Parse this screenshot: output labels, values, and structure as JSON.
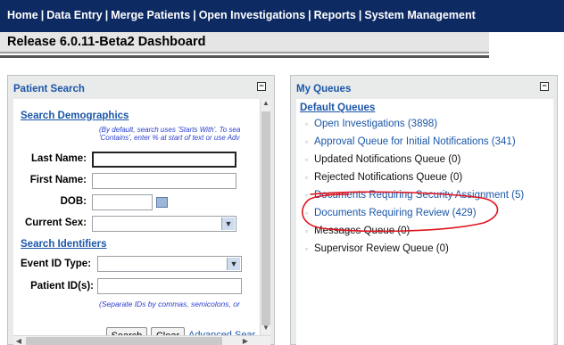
{
  "nav": {
    "items": [
      "Home",
      "Data Entry",
      "Merge Patients",
      "Open Investigations",
      "Reports",
      "System Management"
    ]
  },
  "page_title": "Release 6.0.11-Beta2 Dashboard",
  "patient_search": {
    "title": "Patient Search",
    "demographics_link": "Search Demographics",
    "hint1": "(By default, search uses 'Starts With'. To sea",
    "hint2": "'Contains', enter % at start of text or use Adv",
    "last_name_label": "Last Name:",
    "first_name_label": "First Name:",
    "dob_label": "DOB:",
    "current_sex_label": "Current Sex:",
    "identifiers_link": "Search Identifiers",
    "event_id_type_label": "Event ID Type:",
    "patient_ids_label": "Patient ID(s):",
    "ids_hint": "(Separate IDs by commas, semicolons, or",
    "search_button": "Search",
    "clear_button": "Clear",
    "advanced_link": "Advanced Sear"
  },
  "my_queues": {
    "title": "My Queues",
    "default_queues_link": "Default Queues",
    "items": [
      {
        "label": "Open Investigations (3898)",
        "link": true
      },
      {
        "label": "Approval Queue for Initial Notifications (341)",
        "link": true
      },
      {
        "label": "Updated Notifications Queue (0)",
        "link": false
      },
      {
        "label": "Rejected Notifications Queue (0)",
        "link": false
      },
      {
        "label": "Documents Requiring Security Assignment (5)",
        "link": true
      },
      {
        "label": "Documents Requiring Review (429)",
        "link": true
      },
      {
        "label": "Messages Queue (0)",
        "link": false
      },
      {
        "label": "Supervisor Review Queue (0)",
        "link": false
      }
    ]
  },
  "colors": {
    "nav_bg": "#0d2a63",
    "link": "#1a56a8",
    "panel_bg": "#e9eaea",
    "annotation": "#e0141e"
  }
}
